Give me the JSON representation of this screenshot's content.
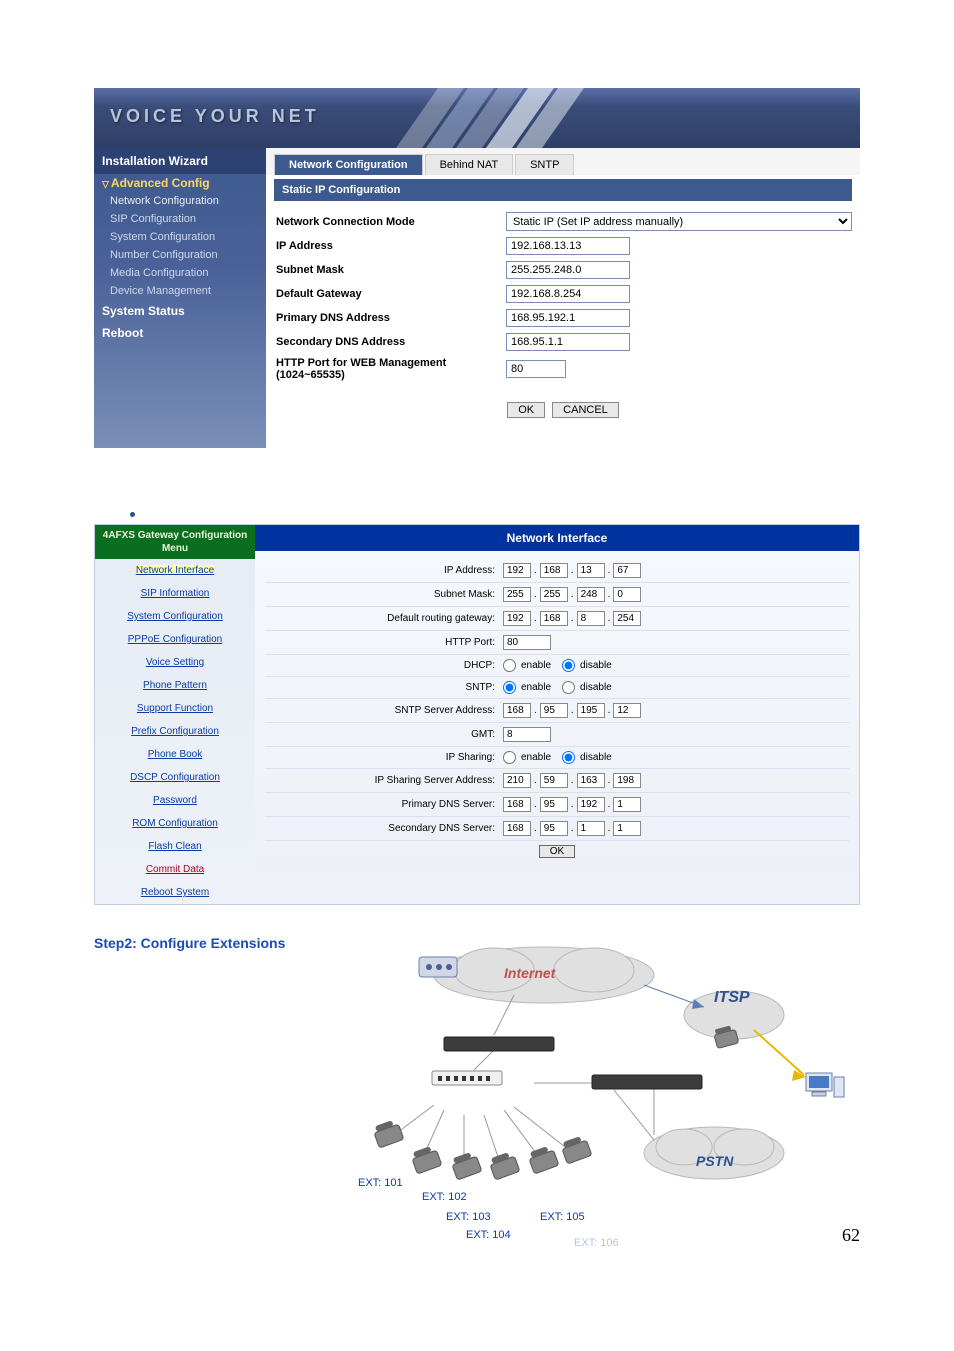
{
  "banner": {
    "text": "VOICE YOUR NET"
  },
  "sidebar1": {
    "header": "Installation Wizard",
    "section": "Advanced Config",
    "items": [
      "Network Configuration",
      "SIP Configuration",
      "System Configuration",
      "Number Configuration",
      "Media Configuration",
      "Device Management"
    ],
    "system_status": "System Status",
    "reboot": "Reboot"
  },
  "tabs1": {
    "network": "Network Configuration",
    "behind_nat": "Behind NAT",
    "sntp": "SNTP"
  },
  "panel1": {
    "title": "Static IP Configuration",
    "rows": {
      "conn_mode": {
        "label": "Network Connection Mode",
        "value": "Static IP (Set IP address manually)"
      },
      "ip": {
        "label": "IP Address",
        "value": "192.168.13.13"
      },
      "subnet": {
        "label": "Subnet Mask",
        "value": "255.255.248.0"
      },
      "gateway": {
        "label": "Default Gateway",
        "value": "192.168.8.254"
      },
      "pdns": {
        "label": "Primary DNS Address",
        "value": "168.95.192.1"
      },
      "sdns": {
        "label": "Secondary DNS Address",
        "value": "168.95.1.1"
      },
      "http": {
        "label": "HTTP Port for WEB Management (1024~65535)",
        "value": "80"
      }
    },
    "ok": "OK",
    "cancel": "CANCEL"
  },
  "sidebar2": {
    "header": "4AFXS Gateway Configuration Menu",
    "items": [
      {
        "label": "Network Interface",
        "active": true
      },
      {
        "label": "SIP Information"
      },
      {
        "label": "System Configuration"
      },
      {
        "label": "PPPoE Configuration"
      },
      {
        "label": "Voice Setting"
      },
      {
        "label": "Phone Pattern"
      },
      {
        "label": "Support Function"
      },
      {
        "label": "Prefix Configuration"
      },
      {
        "label": "Phone Book"
      },
      {
        "label": "DSCP Configuration"
      },
      {
        "label": "Password"
      },
      {
        "label": "ROM Configuration"
      },
      {
        "label": "Flash Clean"
      },
      {
        "label": "Commit Data",
        "red": true
      },
      {
        "label": "Reboot System"
      }
    ]
  },
  "main2": {
    "header": "Network Interface",
    "rows": {
      "ip": {
        "label": "IP Address:",
        "oct": [
          "192",
          "168",
          "13",
          "67"
        ]
      },
      "subnet": {
        "label": "Subnet Mask:",
        "oct": [
          "255",
          "255",
          "248",
          "0"
        ]
      },
      "gateway": {
        "label": "Default routing gateway:",
        "oct": [
          "192",
          "168",
          "8",
          "254"
        ]
      },
      "http": {
        "label": "HTTP Port:",
        "val": "80"
      },
      "dhcp": {
        "label": "DHCP:",
        "enable": "enable",
        "disable": "disable"
      },
      "sntp": {
        "label": "SNTP:",
        "enable": "enable",
        "disable": "disable"
      },
      "sntp_srv": {
        "label": "SNTP Server Address:",
        "oct": [
          "168",
          "95",
          "195",
          "12"
        ]
      },
      "gmt": {
        "label": "GMT:",
        "val": "8"
      },
      "ipshare": {
        "label": "IP Sharing:",
        "enable": "enable",
        "disable": "disable"
      },
      "ipshare_srv": {
        "label": "IP Sharing Server Address:",
        "oct": [
          "210",
          "59",
          "163",
          "198"
        ]
      },
      "pdns": {
        "label": "Primary DNS Server:",
        "oct": [
          "168",
          "95",
          "192",
          "1"
        ]
      },
      "sdns": {
        "label": "Secondary DNS Server:",
        "oct": [
          "168",
          "95",
          "1",
          "1"
        ]
      }
    },
    "ok": "OK"
  },
  "step2": {
    "title": "Step2: Configure Extensions",
    "internet": "Internet",
    "itsp": "ITSP",
    "pstn": "PSTN",
    "ext": {
      "e101": "EXT: 101",
      "e102": "EXT: 102",
      "e103": "EXT: 103",
      "e104": "EXT: 104",
      "e105": "EXT: 105",
      "e106": "EXT: 106"
    }
  },
  "page_num": "62"
}
